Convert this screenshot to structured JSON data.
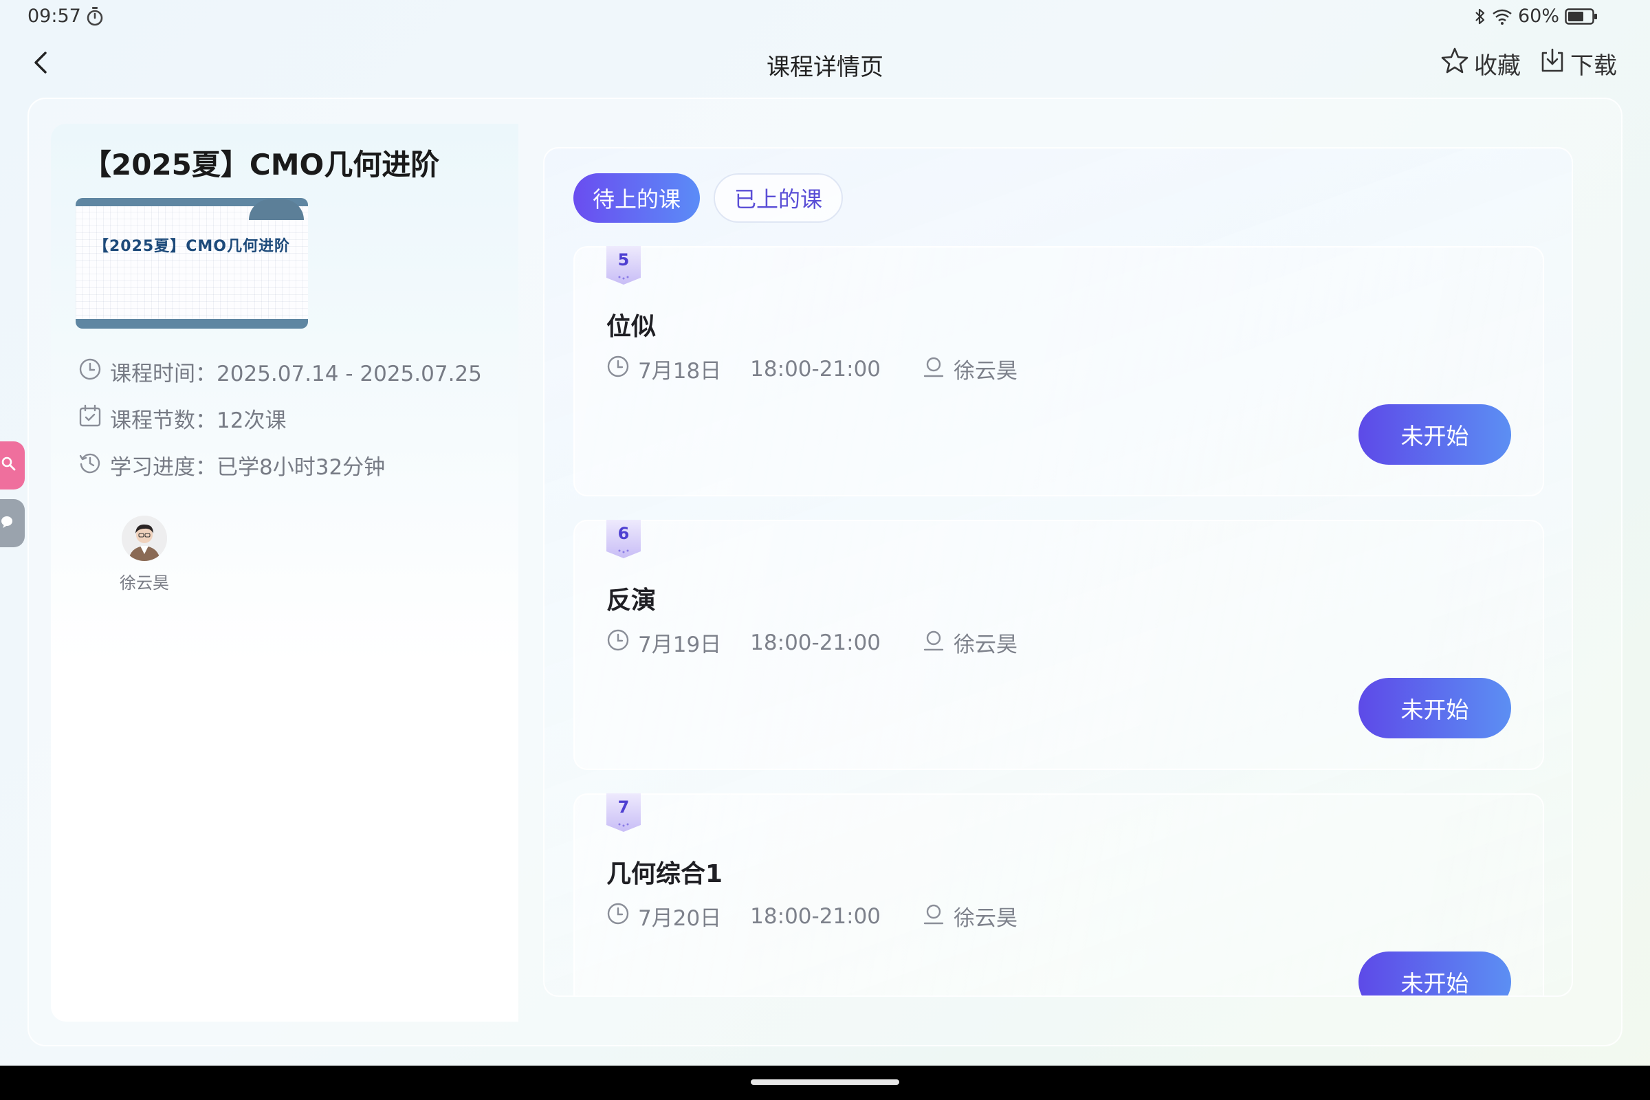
{
  "status_bar": {
    "time": "09:57",
    "battery": "60%"
  },
  "header": {
    "title": "课程详情页",
    "favorite_label": "收藏",
    "download_label": "下载"
  },
  "course": {
    "title": "【2025夏】CMO几何进阶",
    "cover_text": "【2025夏】CMO几何进阶",
    "time_label": "课程时间：",
    "time_value": "2025.07.14 - 2025.07.25",
    "count_label": "课程节数：",
    "count_value": "12次课",
    "progress_label": "学习进度：",
    "progress_value": "已学8小时32分钟",
    "teacher": "徐云昊"
  },
  "tabs": [
    {
      "label": "待上的课",
      "active": true
    },
    {
      "label": "已上的课",
      "active": false
    }
  ],
  "lessons": [
    {
      "index": "5",
      "title": "位似",
      "date": "7月18日",
      "time": "18:00-21:00",
      "teacher": "徐云昊",
      "status": "未开始"
    },
    {
      "index": "6",
      "title": "反演",
      "date": "7月19日",
      "time": "18:00-21:00",
      "teacher": "徐云昊",
      "status": "未开始"
    },
    {
      "index": "7",
      "title": "几何综合1",
      "date": "7月20日",
      "time": "18:00-21:00",
      "teacher": "徐云昊",
      "status": "未开始"
    }
  ],
  "colors": {
    "accent_start": "#6a4df0",
    "accent_end": "#5b8cf7",
    "search_tab": "#ef6f9d",
    "chat_tab": "#9aa3ad"
  }
}
